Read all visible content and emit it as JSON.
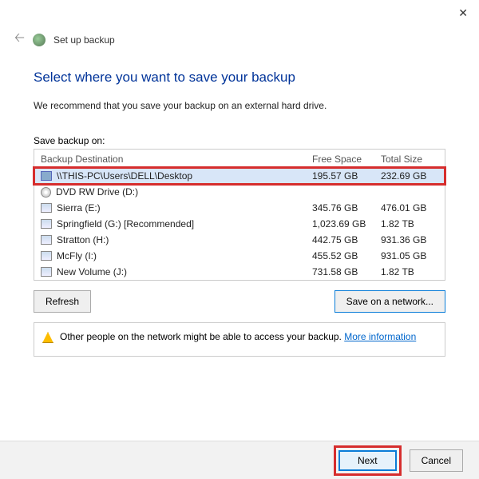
{
  "window": {
    "title": "Set up backup"
  },
  "page": {
    "heading": "Select where you want to save your backup",
    "recommend": "We recommend that you save your backup on an external hard drive.",
    "save_on_label": "Save backup on:"
  },
  "columns": {
    "name": "Backup Destination",
    "free": "Free Space",
    "total": "Total Size"
  },
  "rows": [
    {
      "icon": "computer",
      "name": "\\\\THIS-PC\\Users\\DELL\\Desktop",
      "free": "195.57 GB",
      "total": "232.69 GB",
      "selected": true,
      "highlight": true
    },
    {
      "icon": "disc",
      "name": "DVD RW Drive (D:)",
      "free": "",
      "total": ""
    },
    {
      "icon": "drive",
      "name": "Sierra (E:)",
      "free": "345.76 GB",
      "total": "476.01 GB"
    },
    {
      "icon": "drive",
      "name": "Springfield (G:) [Recommended]",
      "free": "1,023.69 GB",
      "total": "1.82 TB"
    },
    {
      "icon": "drive",
      "name": "Stratton (H:)",
      "free": "442.75 GB",
      "total": "931.36 GB"
    },
    {
      "icon": "drive",
      "name": "McFly (I:)",
      "free": "455.52 GB",
      "total": "931.05 GB"
    },
    {
      "icon": "drive",
      "name": "New Volume (J:)",
      "free": "731.58 GB",
      "total": "1.82 TB"
    }
  ],
  "buttons": {
    "refresh": "Refresh",
    "save_network": "Save on a network...",
    "next": "Next",
    "cancel": "Cancel"
  },
  "warning": {
    "text": "Other people on the network might be able to access your backup.",
    "link": "More information"
  }
}
